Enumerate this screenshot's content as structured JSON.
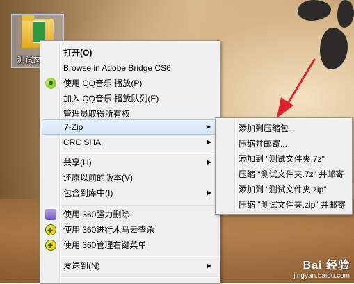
{
  "desktop": {
    "icon_label": "测试文件夹"
  },
  "context_menu": {
    "items": [
      {
        "label": "打开(O)",
        "bold": true
      },
      {
        "label": "Browse in Adobe Bridge CS6"
      },
      {
        "label": "使用 QQ音乐 播放(P)",
        "icon": "qq-music-icon"
      },
      {
        "label": "加入 QQ音乐 播放队列(E)"
      },
      {
        "label": "管理员取得所有权"
      },
      {
        "label": "7-Zip",
        "submenu": true,
        "highlighted": true
      },
      {
        "label": "CRC SHA",
        "submenu": true
      },
      {
        "label": "共享(H)",
        "submenu": true
      },
      {
        "label": "还原以前的版本(V)"
      },
      {
        "label": "包含到库中(I)",
        "submenu": true
      },
      {
        "label": "使用 360强力删除",
        "icon": "shredder-icon"
      },
      {
        "label": "使用 360进行木马云查杀",
        "icon": "360-icon"
      },
      {
        "label": "使用 360管理右键菜单",
        "icon": "360-icon"
      },
      {
        "label": "发送到(N)",
        "submenu": true
      }
    ]
  },
  "zip_submenu": {
    "items": [
      {
        "label": "添加到压缩包..."
      },
      {
        "label": "压缩并邮寄..."
      },
      {
        "label": "添加到 \"测试文件夹.7z\""
      },
      {
        "label": "压缩 \"测试文件夹.7z\" 并邮寄"
      },
      {
        "label": "添加到 \"测试文件夹.zip\""
      },
      {
        "label": "压缩 \"测试文件夹.zip\" 并邮寄"
      }
    ]
  },
  "watermark": {
    "logo": "Bai 经验",
    "url": "jingyan.baidu.com"
  },
  "colors": {
    "annotation_arrow": "#e0202a",
    "menu_bg": "#f0f0f0",
    "highlight": "#d4e6f8"
  }
}
